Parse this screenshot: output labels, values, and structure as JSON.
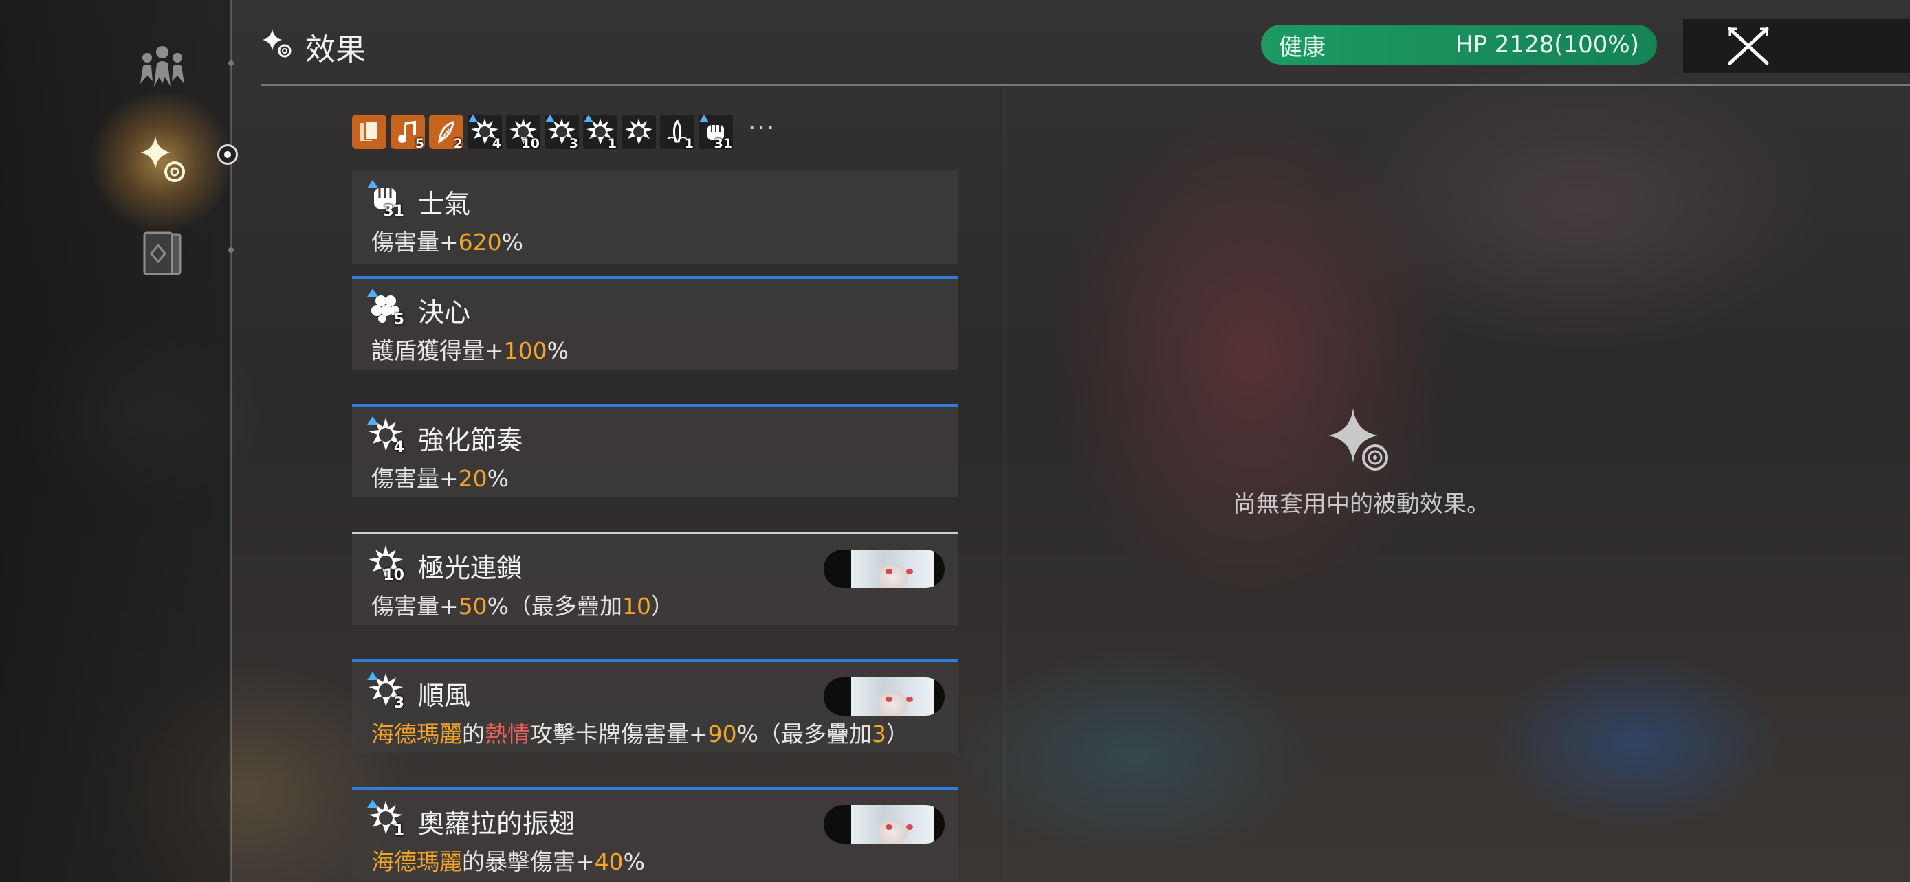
{
  "header": {
    "title": "效果",
    "hp_status": "健康",
    "hp_text": "HP 2128(100%)"
  },
  "sidebar": {
    "items": [
      {
        "icon": "party-icon"
      },
      {
        "icon": "effects-sparkle-icon",
        "active": true
      },
      {
        "icon": "card-deck-icon"
      }
    ]
  },
  "buff_strip": {
    "icons": [
      {
        "icon": "cards-icon",
        "count": ""
      },
      {
        "icon": "music-note-icon",
        "count": "5"
      },
      {
        "icon": "feather-icon",
        "count": "2"
      },
      {
        "icon": "fist-burst-icon",
        "count": "4"
      },
      {
        "icon": "fist-burst-icon",
        "count": "10"
      },
      {
        "icon": "fist-burst-icon",
        "count": "3"
      },
      {
        "icon": "fist-burst-icon",
        "count": "1"
      },
      {
        "icon": "fist-burst-icon",
        "count": ""
      },
      {
        "icon": "wing-icon",
        "count": "1"
      },
      {
        "icon": "fist-icon",
        "count": "31"
      }
    ],
    "more": "···"
  },
  "effects": [
    {
      "name": "士氣",
      "count": "31",
      "desc": [
        "傷害量+",
        "620",
        "%"
      ]
    },
    {
      "name": "決心",
      "count": "5",
      "desc": [
        "護盾獲得量+",
        "100",
        "%"
      ]
    },
    {
      "name": "強化節奏",
      "count": "4",
      "desc": [
        "傷害量+",
        "20",
        "%"
      ]
    },
    {
      "name": "極光連鎖",
      "count": "10",
      "desc": [
        "傷害量+",
        "50",
        "%（最多疊加",
        "10",
        "）"
      ]
    },
    {
      "name": "順風",
      "count": "3",
      "desc": [
        "海德瑪麗",
        "的",
        "熱情",
        "攻擊卡牌傷害量+",
        "90",
        "%（最多疊加",
        "3",
        "）"
      ]
    },
    {
      "name": "奧蘿拉的振翅",
      "count": "1",
      "desc": [
        "海德瑪麗",
        "的暴擊傷害+",
        "40",
        "%"
      ]
    }
  ],
  "passive_panel": {
    "empty_text": "尚無套用中的被動效果。"
  },
  "colors": {
    "accent_orange": "#f3a52a",
    "accent_red": "#f0605a",
    "hp_green": "#1c9a62",
    "divider_blue": "#2f7fd8"
  }
}
